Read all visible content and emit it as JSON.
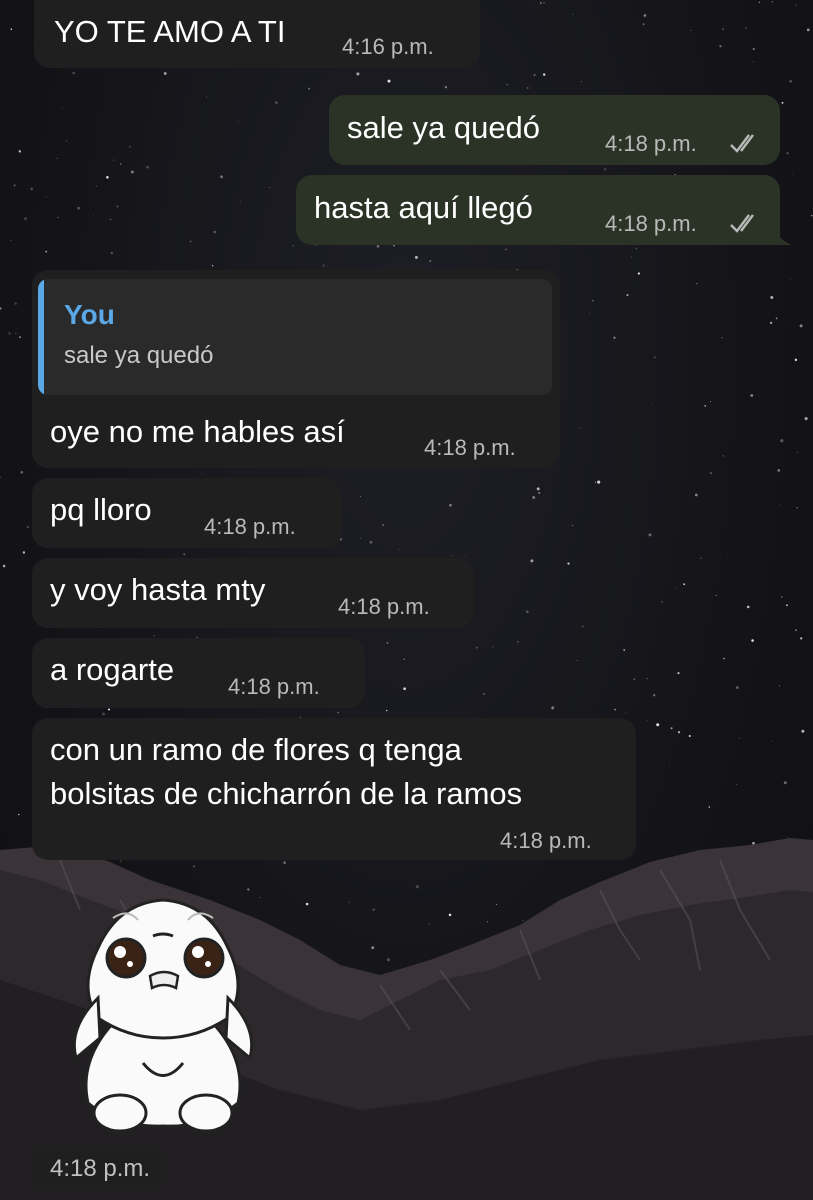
{
  "messages": [
    {
      "text": "YO TE AMO A TI",
      "time": "4:16 p.m.",
      "direction": "incoming"
    },
    {
      "text": "sale ya quedó",
      "time": "4:18 p.m.",
      "direction": "outgoing",
      "status": "read"
    },
    {
      "text": "hasta aquí llegó",
      "time": "4:18 p.m.",
      "direction": "outgoing",
      "status": "read"
    },
    {
      "text": "oye no me hables así",
      "time": "4:18 p.m.",
      "direction": "incoming",
      "reply": {
        "author": "You",
        "text": "sale ya quedó"
      }
    },
    {
      "text": "pq lloro",
      "time": "4:18 p.m.",
      "direction": "incoming"
    },
    {
      "text": "y voy hasta mty",
      "time": "4:18 p.m.",
      "direction": "incoming"
    },
    {
      "text": "a rogarte",
      "time": "4:18 p.m.",
      "direction": "incoming"
    },
    {
      "lines": [
        "con un ramo de flores q tenga",
        "bolsitas de chicharrón de la ramos"
      ],
      "time": "4:18 p.m.",
      "direction": "incoming"
    },
    {
      "type": "sticker",
      "sticker": "white-furry-creature-sticker",
      "time": "4:18 p.m.",
      "direction": "incoming"
    }
  ],
  "colors": {
    "incoming_bubble": "#1f1f20",
    "outgoing_bubble": "#2b3327",
    "reply_accent": "#5aa8e6",
    "time_text": "#b9b9b9"
  },
  "icons": {
    "read_receipt": "double-check-icon"
  }
}
